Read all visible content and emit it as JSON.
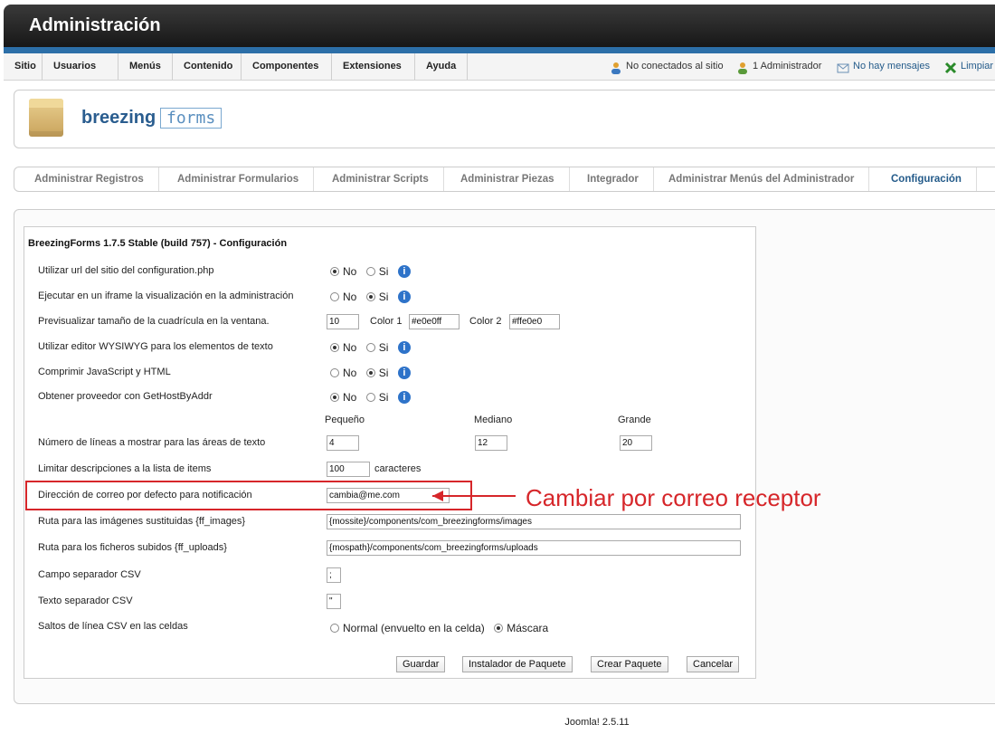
{
  "header": {
    "title": "Administración"
  },
  "menu": [
    "Sitio",
    "Usuarios",
    "Menús",
    "Contenido",
    "Componentes",
    "Extensiones",
    "Ayuda"
  ],
  "status": {
    "not_connected": "No conectados al sitio",
    "admins": "1 Administrador",
    "messages": "No hay mensajes",
    "clear": "Limpiar"
  },
  "logo": {
    "part1": "breezing",
    "part2": "forms"
  },
  "tabs": [
    "Administrar Registros",
    "Administrar Formularios",
    "Administrar Scripts",
    "Administrar Piezas",
    "Integrador",
    "Administrar Menús del Administrador",
    "Configuración"
  ],
  "config": {
    "title": "BreezingForms 1.7.5 Stable (build 757) - Configuración",
    "no": "No",
    "si": "Si",
    "rows": {
      "site_url": "Utilizar url del sitio del configuration.php",
      "iframe": "Ejecutar en un iframe la visualización en la administración",
      "grid": "Previsualizar tamaño de la cuadrícula en la ventana.",
      "wysiwyg": "Utilizar editor WYSIWYG para los elementos de texto",
      "compress": "Comprimir JavaScript y HTML",
      "gethost": "Obtener proveedor con GetHostByAddr",
      "lines": "Número de líneas a mostrar para las áreas de texto",
      "limit": "Limitar descripciones a la lista de items",
      "email": "Dirección de correo por defecto para notificación",
      "images": "Ruta para las imágenes sustituidas {ff_images}",
      "uploads": "Ruta para los ficheros subidos {ff_uploads}",
      "csv_sep": "Campo separador CSV",
      "csv_text": "Texto separador CSV",
      "csv_breaks": "Saltos de línea CSV en las celdas"
    },
    "grid_size": "10",
    "color1_label": "Color 1",
    "color1": "#e0e0ff",
    "color2_label": "Color 2",
    "color2": "#ffe0e0",
    "size_small": "Pequeño",
    "size_medium": "Mediano",
    "size_large": "Grande",
    "lines_small": "4",
    "lines_medium": "12",
    "lines_large": "20",
    "limit_value": "100",
    "chars": "caracteres",
    "email_value": "cambia@me.com",
    "images_value": "{mossite}/components/com_breezingforms/images",
    "uploads_value": "{mospath}/components/com_breezingforms/uploads",
    "csv_sep_value": ";",
    "csv_text_value": "\"",
    "normal": "Normal (envuelto en la celda)",
    "mask": "Máscara",
    "buttons": {
      "save": "Guardar",
      "installer": "Instalador de Paquete",
      "create": "Crear Paquete",
      "cancel": "Cancelar"
    }
  },
  "annotation": "Cambiar por correo receptor",
  "footer": "Joomla! 2.5.11"
}
